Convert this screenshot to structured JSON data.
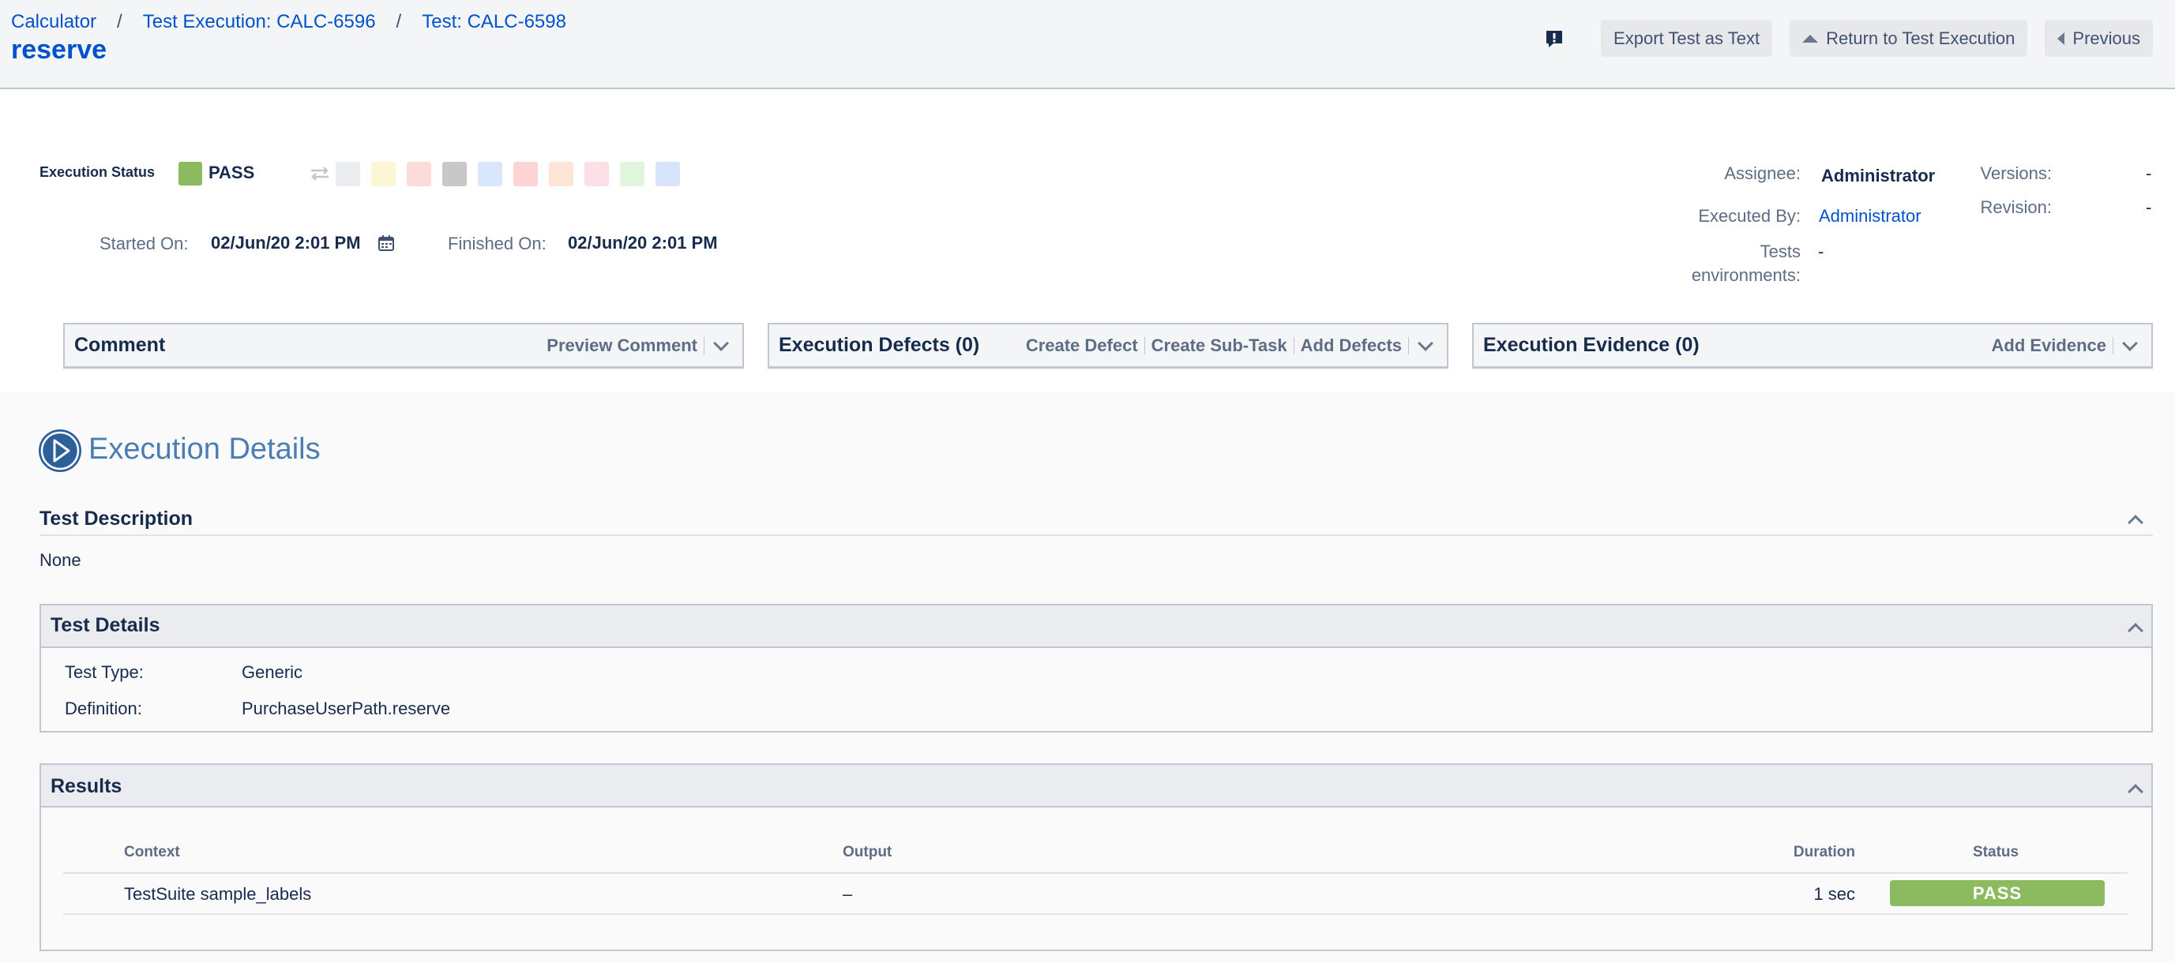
{
  "breadcrumb": {
    "project": "Calculator",
    "execution": "Test Execution: CALC-6596",
    "test": "Test: CALC-6598",
    "separator": "/"
  },
  "page_title": "reserve",
  "header_actions": {
    "feedback_icon": "feedback-icon",
    "export_label": "Export Test as Text",
    "return_label": "Return to Test Execution",
    "previous_label": "Previous"
  },
  "execution": {
    "status_label": "Execution Status",
    "status_value": "PASS",
    "status_color": "#8cba5e",
    "status_options": [
      "#ebecf0",
      "#fbf7d5",
      "#fbdcd8",
      "#c8c8c8",
      "#d9e6fb",
      "#fcd5d2",
      "#fde5d8",
      "#fde0e7",
      "#e0f5dc",
      "#d8e4fb"
    ],
    "started_label": "Started On:",
    "started_value": "02/Jun/20 2:01 PM",
    "finished_label": "Finished On:",
    "finished_value": "02/Jun/20 2:01 PM"
  },
  "meta": {
    "assignee_label": "Assignee:",
    "assignee_value": "Administrator",
    "executed_by_label": "Executed By:",
    "executed_by_value": "Administrator",
    "tests_env_label_1": "Tests",
    "tests_env_label_2": "environments:",
    "tests_env_value": "-",
    "versions_label": "Versions:",
    "versions_value": "-",
    "revision_label": "Revision:",
    "revision_value": "-"
  },
  "panels": {
    "comment": {
      "title": "Comment",
      "actions": [
        "Preview Comment"
      ]
    },
    "defects": {
      "title": "Execution Defects (0)",
      "actions": [
        "Create Defect",
        "Create Sub-Task",
        "Add Defects"
      ]
    },
    "evidence": {
      "title": "Execution Evidence (0)",
      "actions": [
        "Add Evidence"
      ]
    }
  },
  "details": {
    "heading": "Execution Details",
    "description_title": "Test Description",
    "description_value": "None",
    "test_details_title": "Test Details",
    "test_type_label": "Test Type:",
    "test_type_value": "Generic",
    "definition_label": "Definition:",
    "definition_value": "PurchaseUserPath.reserve"
  },
  "results": {
    "title": "Results",
    "columns": [
      "Context",
      "Output",
      "Duration",
      "Status"
    ],
    "rows": [
      {
        "context": "TestSuite sample_labels",
        "output": "–",
        "duration": "1 sec",
        "status": "PASS"
      }
    ]
  }
}
